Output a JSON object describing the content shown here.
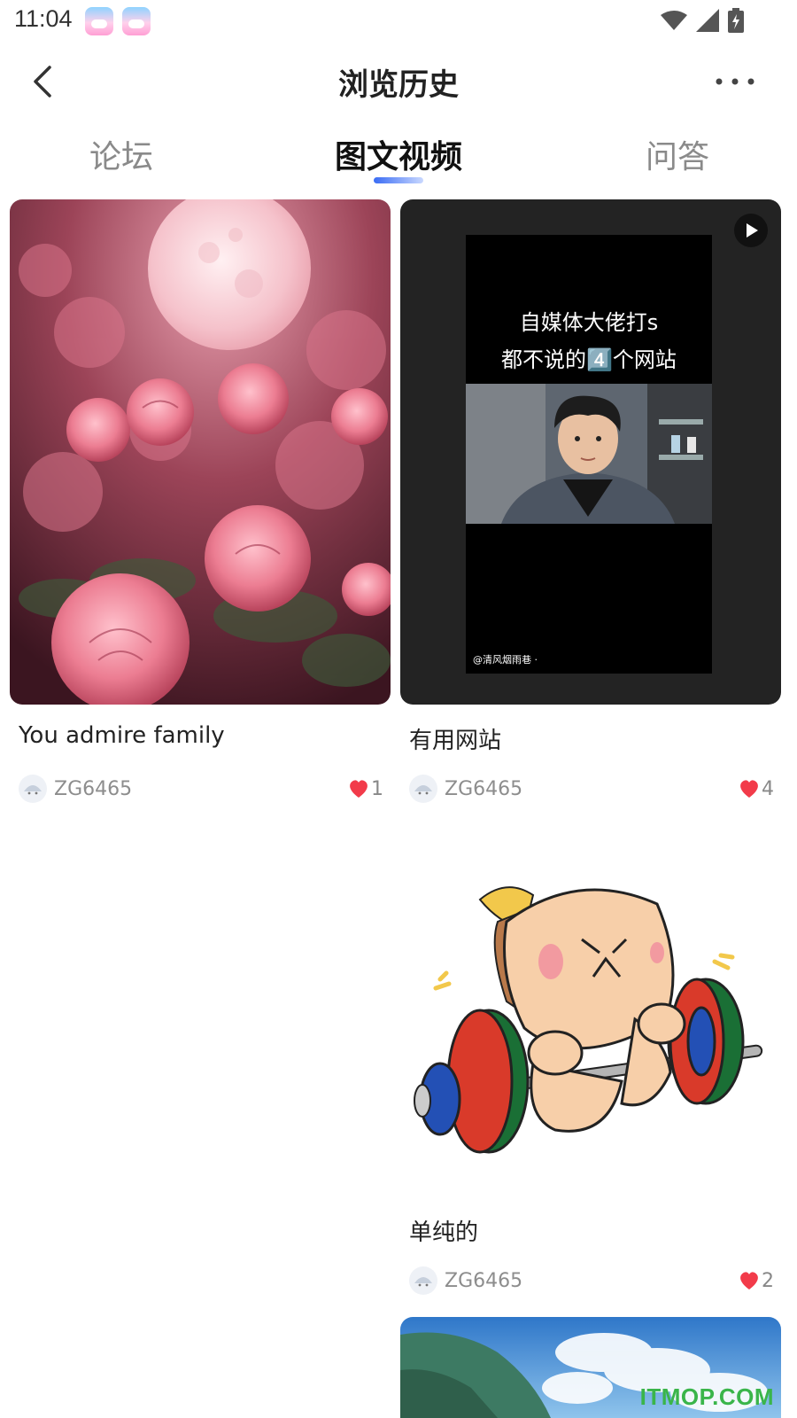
{
  "status_bar": {
    "time": "11:04"
  },
  "header": {
    "title": "浏览历史"
  },
  "tabs": [
    {
      "label": "论坛",
      "active": false
    },
    {
      "label": "图文视频",
      "active": true
    },
    {
      "label": "问答",
      "active": false
    }
  ],
  "posts": [
    {
      "caption": "You admire family",
      "author": "ZG6465",
      "likes": "1",
      "media": "pink-roses-full-moon-image"
    },
    {
      "caption": "有用网站",
      "author": "ZG6465",
      "likes": "4",
      "media": "video",
      "video_text_line1": "自媒体大佬打s",
      "video_text_line2": "都不说的4️⃣个网站",
      "video_credit": "@清风烟雨巷 ·"
    },
    {
      "caption": "单纯的",
      "author": "ZG6465",
      "likes": "2",
      "media": "cartoon-weightlifting-sticker"
    },
    {
      "caption": "",
      "author": "",
      "likes": "",
      "media": "sky-landscape-image"
    }
  ],
  "watermark": "ITMOP.COM",
  "colors": {
    "accent": "#3a6cf4",
    "like": "#f23b4a",
    "watermark": "#3ab54a"
  }
}
